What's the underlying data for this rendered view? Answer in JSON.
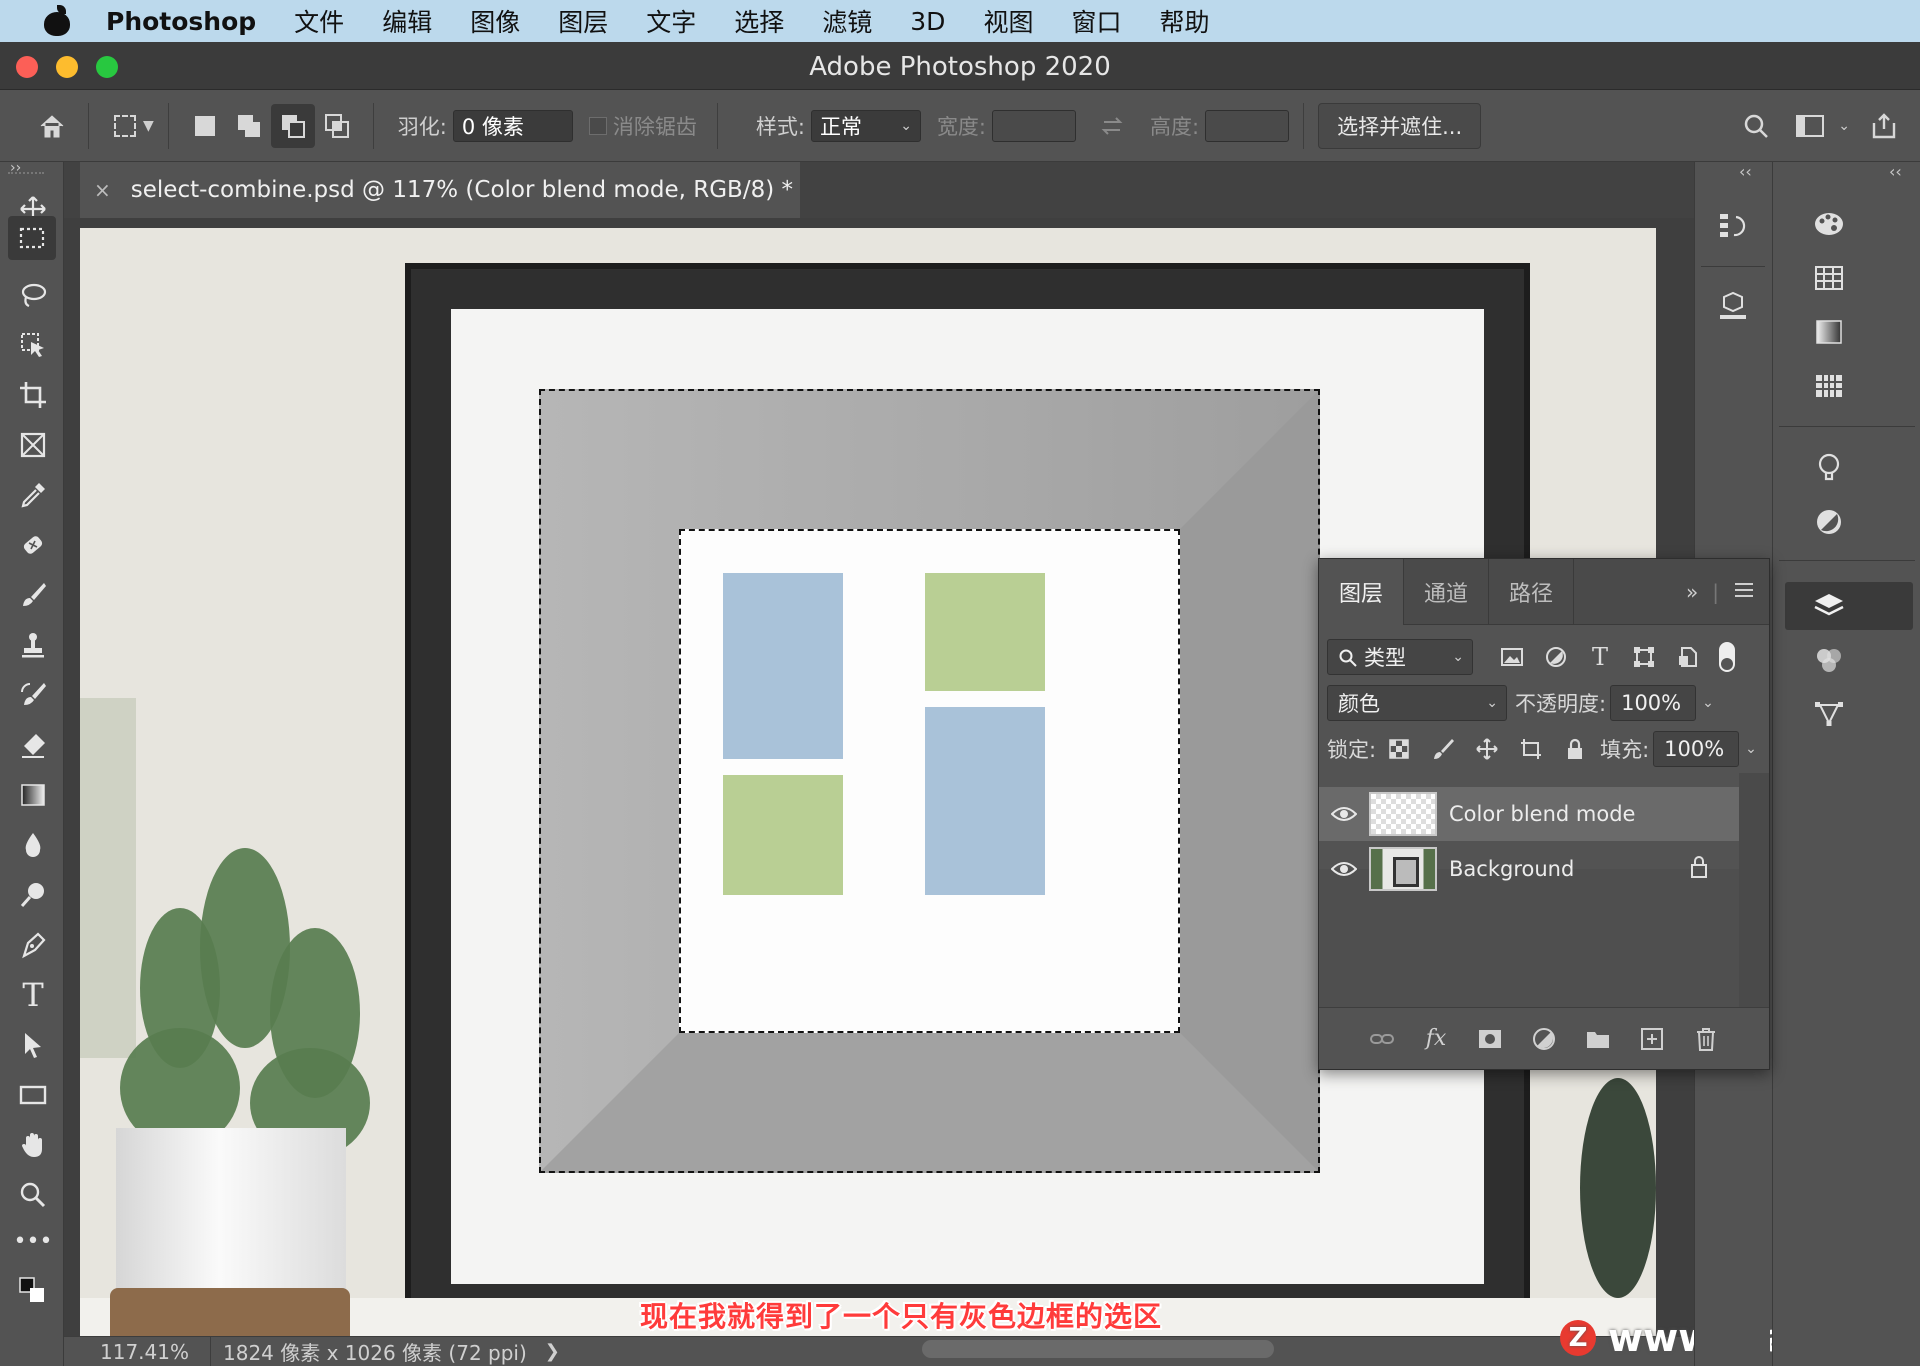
{
  "menubar": {
    "app_name": "Photoshop",
    "items": [
      "文件",
      "编辑",
      "图像",
      "图层",
      "文字",
      "选择",
      "滤镜",
      "3D",
      "视图",
      "窗口",
      "帮助"
    ]
  },
  "window": {
    "title": "Adobe Photoshop 2020"
  },
  "options": {
    "feather_label": "羽化:",
    "feather_value": "0 像素",
    "antialias_label": "消除锯齿",
    "style_label": "样式:",
    "style_value": "正常",
    "width_label": "宽度:",
    "height_label": "高度:",
    "select_mask_label": "选择并遮住..."
  },
  "document": {
    "tab_title": "select-combine.psd @ 117% (Color blend mode, RGB/8) *",
    "tab_close": "×"
  },
  "caption": "现在我就得到了一个只有灰色边框的选区",
  "status": {
    "zoom": "117.41%",
    "dimensions": "1824 像素 x 1026 像素 (72 ppi)",
    "arrow": "❯"
  },
  "watermark": {
    "logo": "Z",
    "text": "www.MacZ.com"
  },
  "layers_panel": {
    "tabs": [
      "图层",
      "通道",
      "路径"
    ],
    "expand": "»",
    "filter_value": "类型",
    "blend_mode": "颜色",
    "opacity_label": "不透明度:",
    "opacity_value": "100%",
    "lock_label": "锁定:",
    "fill_label": "填充:",
    "fill_value": "100%",
    "layers": [
      {
        "name": "Color blend mode"
      },
      {
        "name": "Background"
      }
    ],
    "fx_label": "fx"
  },
  "colors": {
    "accent_red": "#fc5f57",
    "selection_gray": "#a8a8a8",
    "tile_blue": "#a9c2d9",
    "tile_green": "#b9cf94"
  }
}
